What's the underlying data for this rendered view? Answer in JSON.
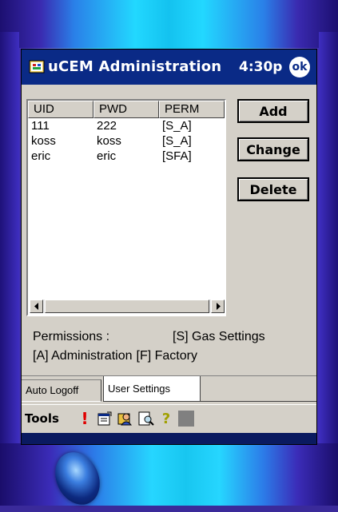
{
  "device": {
    "title_app": "uCEM Administration",
    "clock": "4:30p",
    "ok_label": "ok"
  },
  "list": {
    "columns": [
      "UID",
      "PWD",
      "PERM"
    ],
    "rows": [
      [
        "111",
        "222",
        "[S_A]"
      ],
      [
        "koss",
        "koss",
        "[S_A]"
      ],
      [
        "eric",
        "eric",
        "[SFA]"
      ]
    ]
  },
  "buttons": {
    "add": "Add",
    "change": "Change",
    "delete": "Delete"
  },
  "legend": {
    "permissions_label": "Permissions :",
    "gas_settings": "[S] Gas Settings",
    "administration": "[A] Administration",
    "factory": "[F] Factory"
  },
  "tabs": [
    "Auto Logoff",
    "User Settings"
  ],
  "toolbar": {
    "tools_label": "Tools",
    "icons": [
      "exclamation-icon",
      "properties-icon",
      "user-icon",
      "find-icon",
      "help-icon",
      "square-icon"
    ],
    "exclamation": "!",
    "help": "?"
  }
}
